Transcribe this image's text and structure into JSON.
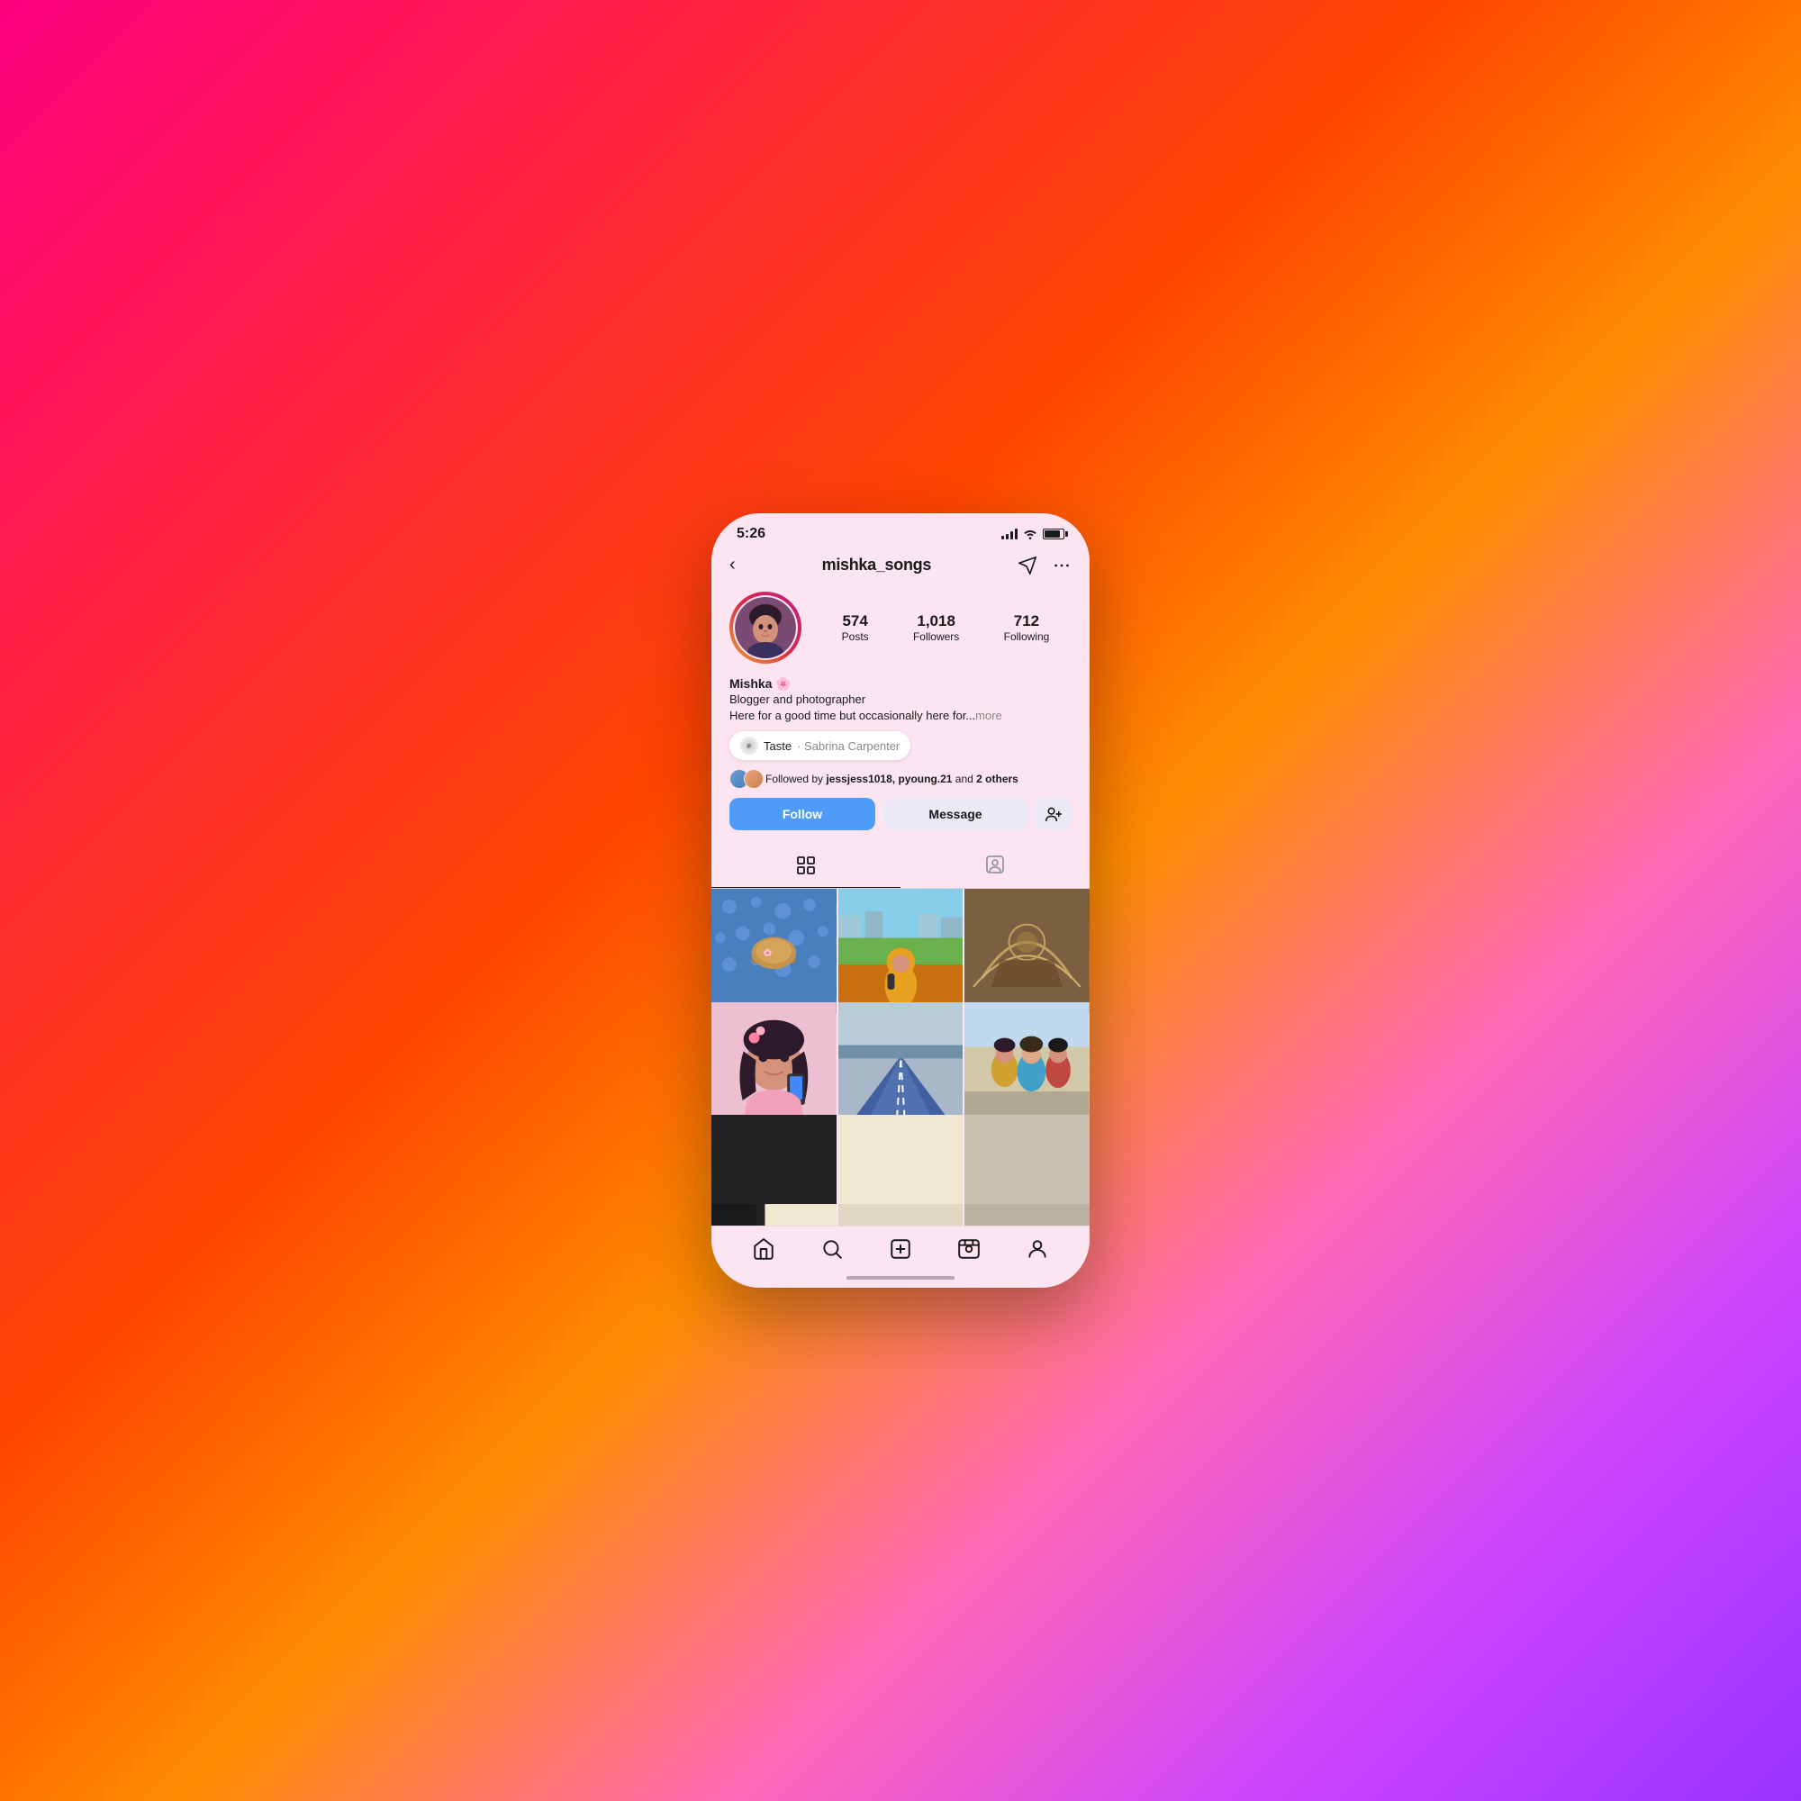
{
  "background": {
    "gradient": "linear-gradient(135deg, #ff0080, #ff4500, #ff8c00, #ff69b4, #cc44ff, #9933ff)"
  },
  "phone": {
    "status_bar": {
      "time": "5:26",
      "signal_label": "signal",
      "wifi_label": "wifi",
      "battery_label": "battery"
    },
    "header": {
      "back_label": "‹",
      "username": "mishka_songs",
      "send_icon_label": "send",
      "more_icon_label": "more"
    },
    "profile": {
      "avatar_emoji": "🧑",
      "display_name": "Mishka 🌸",
      "bio_line1": "Blogger and photographer",
      "bio_line2": "Here for a good time but occasionally here for...",
      "bio_more": "more",
      "stats": {
        "posts_count": "574",
        "posts_label": "Posts",
        "followers_count": "1,018",
        "followers_label": "Followers",
        "following_count": "712",
        "following_label": "Following"
      },
      "music": {
        "song": "Taste",
        "separator": " · ",
        "artist": "Sabrina Carpenter"
      },
      "followed_by": {
        "text_prefix": "Followed by ",
        "users": "jessjess1018, pyoung.21",
        "text_suffix": " and ",
        "others_count": "2 others"
      },
      "buttons": {
        "follow": "Follow",
        "message": "Message",
        "add_person": "➕"
      }
    },
    "tabs": {
      "grid_label": "grid",
      "tagged_label": "tagged"
    },
    "bottom_nav": {
      "home": "home",
      "search": "search",
      "create": "create",
      "reels": "reels",
      "profile": "profile"
    }
  }
}
